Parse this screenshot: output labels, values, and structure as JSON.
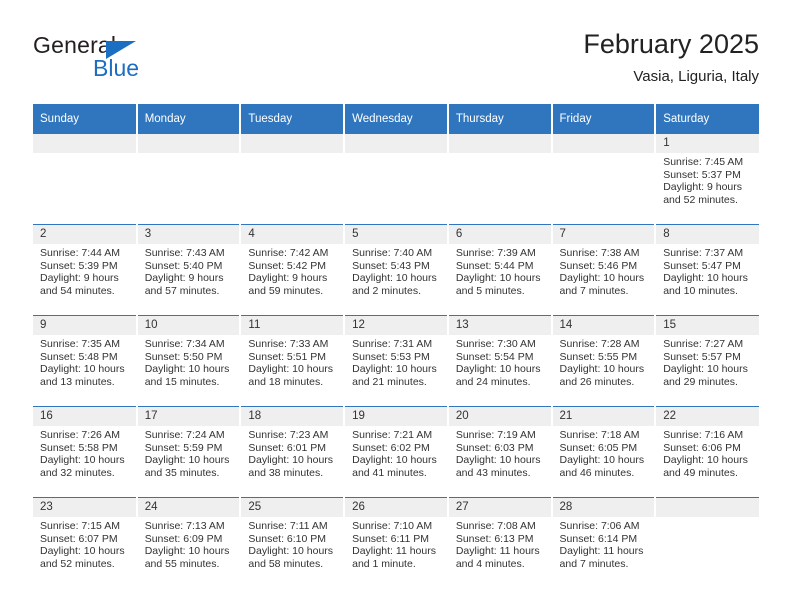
{
  "brand": {
    "name_part1": "General",
    "name_part2": "Blue",
    "logo_icon": "triangle-logo-icon"
  },
  "header": {
    "title": "February 2025",
    "subtitle": "Vasia, Liguria, Italy"
  },
  "colors": {
    "header_blue": "#3076bf",
    "brand_blue": "#1b6ec2",
    "daynum_gray": "#efefef",
    "text": "#333333"
  },
  "weekdays": [
    "Sunday",
    "Monday",
    "Tuesday",
    "Wednesday",
    "Thursday",
    "Friday",
    "Saturday"
  ],
  "weeks": [
    [
      {
        "day": "",
        "sunrise": "",
        "sunset": "",
        "daylight": "",
        "daylight2": ""
      },
      {
        "day": "",
        "sunrise": "",
        "sunset": "",
        "daylight": "",
        "daylight2": ""
      },
      {
        "day": "",
        "sunrise": "",
        "sunset": "",
        "daylight": "",
        "daylight2": ""
      },
      {
        "day": "",
        "sunrise": "",
        "sunset": "",
        "daylight": "",
        "daylight2": ""
      },
      {
        "day": "",
        "sunrise": "",
        "sunset": "",
        "daylight": "",
        "daylight2": ""
      },
      {
        "day": "",
        "sunrise": "",
        "sunset": "",
        "daylight": "",
        "daylight2": ""
      },
      {
        "day": "1",
        "sunrise": "Sunrise: 7:45 AM",
        "sunset": "Sunset: 5:37 PM",
        "daylight": "Daylight: 9 hours",
        "daylight2": "and 52 minutes."
      }
    ],
    [
      {
        "day": "2",
        "sunrise": "Sunrise: 7:44 AM",
        "sunset": "Sunset: 5:39 PM",
        "daylight": "Daylight: 9 hours",
        "daylight2": "and 54 minutes."
      },
      {
        "day": "3",
        "sunrise": "Sunrise: 7:43 AM",
        "sunset": "Sunset: 5:40 PM",
        "daylight": "Daylight: 9 hours",
        "daylight2": "and 57 minutes."
      },
      {
        "day": "4",
        "sunrise": "Sunrise: 7:42 AM",
        "sunset": "Sunset: 5:42 PM",
        "daylight": "Daylight: 9 hours",
        "daylight2": "and 59 minutes."
      },
      {
        "day": "5",
        "sunrise": "Sunrise: 7:40 AM",
        "sunset": "Sunset: 5:43 PM",
        "daylight": "Daylight: 10 hours",
        "daylight2": "and 2 minutes."
      },
      {
        "day": "6",
        "sunrise": "Sunrise: 7:39 AM",
        "sunset": "Sunset: 5:44 PM",
        "daylight": "Daylight: 10 hours",
        "daylight2": "and 5 minutes."
      },
      {
        "day": "7",
        "sunrise": "Sunrise: 7:38 AM",
        "sunset": "Sunset: 5:46 PM",
        "daylight": "Daylight: 10 hours",
        "daylight2": "and 7 minutes."
      },
      {
        "day": "8",
        "sunrise": "Sunrise: 7:37 AM",
        "sunset": "Sunset: 5:47 PM",
        "daylight": "Daylight: 10 hours",
        "daylight2": "and 10 minutes."
      }
    ],
    [
      {
        "day": "9",
        "sunrise": "Sunrise: 7:35 AM",
        "sunset": "Sunset: 5:48 PM",
        "daylight": "Daylight: 10 hours",
        "daylight2": "and 13 minutes."
      },
      {
        "day": "10",
        "sunrise": "Sunrise: 7:34 AM",
        "sunset": "Sunset: 5:50 PM",
        "daylight": "Daylight: 10 hours",
        "daylight2": "and 15 minutes."
      },
      {
        "day": "11",
        "sunrise": "Sunrise: 7:33 AM",
        "sunset": "Sunset: 5:51 PM",
        "daylight": "Daylight: 10 hours",
        "daylight2": "and 18 minutes."
      },
      {
        "day": "12",
        "sunrise": "Sunrise: 7:31 AM",
        "sunset": "Sunset: 5:53 PM",
        "daylight": "Daylight: 10 hours",
        "daylight2": "and 21 minutes."
      },
      {
        "day": "13",
        "sunrise": "Sunrise: 7:30 AM",
        "sunset": "Sunset: 5:54 PM",
        "daylight": "Daylight: 10 hours",
        "daylight2": "and 24 minutes."
      },
      {
        "day": "14",
        "sunrise": "Sunrise: 7:28 AM",
        "sunset": "Sunset: 5:55 PM",
        "daylight": "Daylight: 10 hours",
        "daylight2": "and 26 minutes."
      },
      {
        "day": "15",
        "sunrise": "Sunrise: 7:27 AM",
        "sunset": "Sunset: 5:57 PM",
        "daylight": "Daylight: 10 hours",
        "daylight2": "and 29 minutes."
      }
    ],
    [
      {
        "day": "16",
        "sunrise": "Sunrise: 7:26 AM",
        "sunset": "Sunset: 5:58 PM",
        "daylight": "Daylight: 10 hours",
        "daylight2": "and 32 minutes."
      },
      {
        "day": "17",
        "sunrise": "Sunrise: 7:24 AM",
        "sunset": "Sunset: 5:59 PM",
        "daylight": "Daylight: 10 hours",
        "daylight2": "and 35 minutes."
      },
      {
        "day": "18",
        "sunrise": "Sunrise: 7:23 AM",
        "sunset": "Sunset: 6:01 PM",
        "daylight": "Daylight: 10 hours",
        "daylight2": "and 38 minutes."
      },
      {
        "day": "19",
        "sunrise": "Sunrise: 7:21 AM",
        "sunset": "Sunset: 6:02 PM",
        "daylight": "Daylight: 10 hours",
        "daylight2": "and 41 minutes."
      },
      {
        "day": "20",
        "sunrise": "Sunrise: 7:19 AM",
        "sunset": "Sunset: 6:03 PM",
        "daylight": "Daylight: 10 hours",
        "daylight2": "and 43 minutes."
      },
      {
        "day": "21",
        "sunrise": "Sunrise: 7:18 AM",
        "sunset": "Sunset: 6:05 PM",
        "daylight": "Daylight: 10 hours",
        "daylight2": "and 46 minutes."
      },
      {
        "day": "22",
        "sunrise": "Sunrise: 7:16 AM",
        "sunset": "Sunset: 6:06 PM",
        "daylight": "Daylight: 10 hours",
        "daylight2": "and 49 minutes."
      }
    ],
    [
      {
        "day": "23",
        "sunrise": "Sunrise: 7:15 AM",
        "sunset": "Sunset: 6:07 PM",
        "daylight": "Daylight: 10 hours",
        "daylight2": "and 52 minutes."
      },
      {
        "day": "24",
        "sunrise": "Sunrise: 7:13 AM",
        "sunset": "Sunset: 6:09 PM",
        "daylight": "Daylight: 10 hours",
        "daylight2": "and 55 minutes."
      },
      {
        "day": "25",
        "sunrise": "Sunrise: 7:11 AM",
        "sunset": "Sunset: 6:10 PM",
        "daylight": "Daylight: 10 hours",
        "daylight2": "and 58 minutes."
      },
      {
        "day": "26",
        "sunrise": "Sunrise: 7:10 AM",
        "sunset": "Sunset: 6:11 PM",
        "daylight": "Daylight: 11 hours",
        "daylight2": "and 1 minute."
      },
      {
        "day": "27",
        "sunrise": "Sunrise: 7:08 AM",
        "sunset": "Sunset: 6:13 PM",
        "daylight": "Daylight: 11 hours",
        "daylight2": "and 4 minutes."
      },
      {
        "day": "28",
        "sunrise": "Sunrise: 7:06 AM",
        "sunset": "Sunset: 6:14 PM",
        "daylight": "Daylight: 11 hours",
        "daylight2": "and 7 minutes."
      },
      {
        "day": "",
        "sunrise": "",
        "sunset": "",
        "daylight": "",
        "daylight2": ""
      }
    ]
  ]
}
